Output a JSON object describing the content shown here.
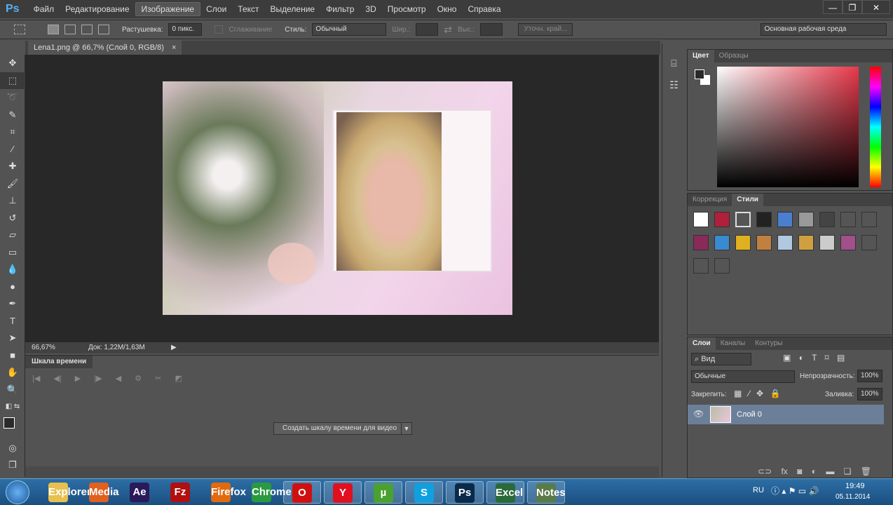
{
  "app": {
    "logo": "Ps"
  },
  "menu": [
    "Файл",
    "Редактирование",
    "Изображение",
    "Слои",
    "Текст",
    "Выделение",
    "Фильтр",
    "3D",
    "Просмотр",
    "Окно",
    "Справка"
  ],
  "window_controls": {
    "minimize": "—",
    "restore": "❐",
    "close": "✕"
  },
  "options": {
    "feather_label": "Растушевка:",
    "feather_value": "0 пикс.",
    "antialias": "Сглаживание",
    "style_label": "Стиль:",
    "style_value": "Обычный",
    "width_label": "Шир.:",
    "height_label": "Выс.:",
    "refine_edge": "Уточн. край...",
    "workspace": "Основная рабочая среда"
  },
  "document": {
    "tab": "Lena1.png @ 66,7% (Слой 0, RGB/8)",
    "close": "×",
    "zoom": "66,67%",
    "doc_size": "Док: 1,22M/1,63M"
  },
  "timeline": {
    "title": "Шкала времени",
    "create_button": "Создать шкалу времени для видео"
  },
  "color_panel": {
    "tabs": [
      "Цвет",
      "Образцы"
    ],
    "hue_color": "#e8384a"
  },
  "styles_panel": {
    "tabs": [
      "Коррекция",
      "Стили"
    ],
    "swatches": [
      "#fff",
      "#b0203a",
      "#555",
      "#222",
      "#4a7fd0",
      "#999",
      "#444",
      "#555",
      "#555",
      "#8a2a5a",
      "#3a8ad0",
      "#e0b020",
      "#c08040",
      "#b0c8e0",
      "#d0a040",
      "#ccc",
      "#a0508a",
      "#555",
      "#555",
      "#555"
    ]
  },
  "layers_panel": {
    "tabs": [
      "Слои",
      "Каналы",
      "Контуры"
    ],
    "filter": "Вид",
    "blend_mode": "Обычные",
    "opacity_label": "Непрозрачность:",
    "opacity_value": "100%",
    "lock_label": "Закрепить:",
    "fill_label": "Заливка:",
    "fill_value": "100%",
    "layers": [
      {
        "name": "Слой 0",
        "visible": true,
        "selected": true
      }
    ]
  },
  "taskbar": {
    "apps": [
      "Explorer",
      "Media",
      "Ae",
      "Fz",
      "Firefox",
      "Chrome",
      "O",
      "Y",
      "µ",
      "S",
      "Ps",
      "Excel",
      "Notes"
    ],
    "lang": "RU",
    "time": "19:49",
    "date": "05.11.2014"
  }
}
